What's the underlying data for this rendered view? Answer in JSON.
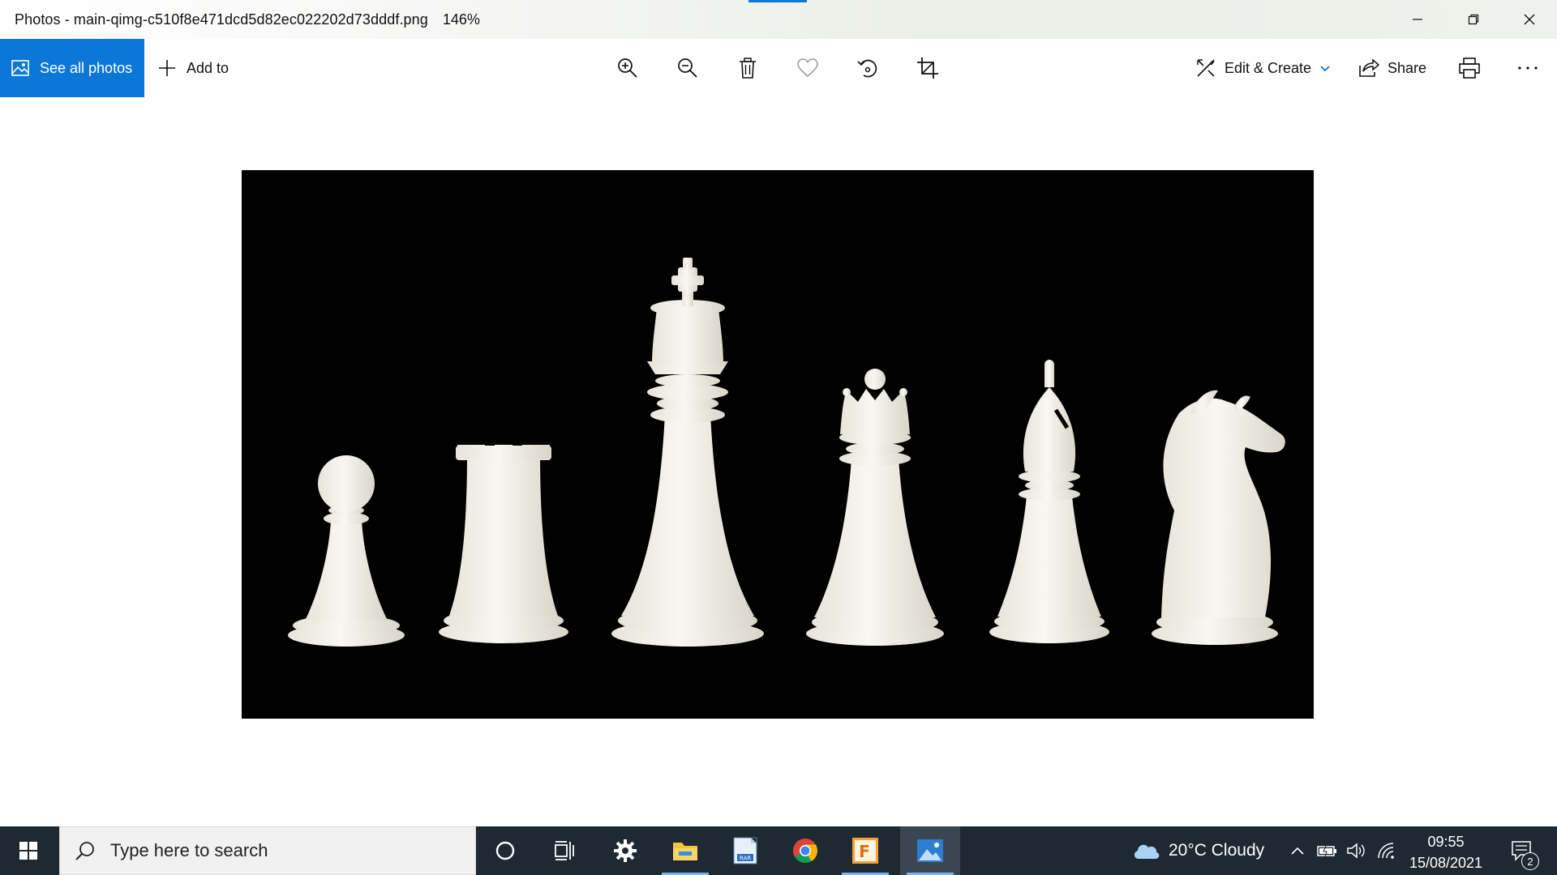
{
  "window": {
    "title": "Photos - main-qimg-c510f8e471dcd5d82ec022202d73dddf.png",
    "zoom": "146%"
  },
  "commandbar": {
    "see_all_label": "See all photos",
    "add_to_label": "Add to",
    "edit_create_label": "Edit & Create",
    "share_label": "Share"
  },
  "photo": {
    "pieces": [
      "pawn",
      "rook",
      "king",
      "queen",
      "bishop",
      "knight"
    ]
  },
  "taskbar": {
    "search_placeholder": "Type here to search",
    "weather": "20°C  Cloudy",
    "time": "09:55",
    "date": "15/08/2021",
    "notification_count": "2"
  },
  "colors": {
    "accent": "#0b78d7",
    "taskbar_bg": "#1f2932",
    "photo_bg": "#000000",
    "piece": "#f3f1ea"
  }
}
